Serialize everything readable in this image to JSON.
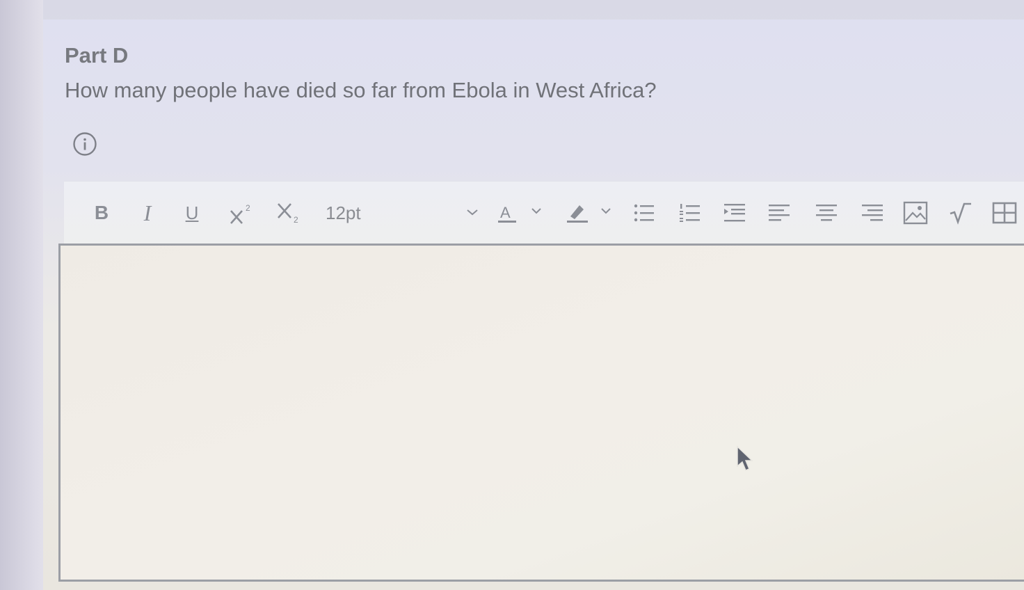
{
  "question": {
    "part_label": "Part D",
    "text": "How many people have died so far from Ebola in West Africa?",
    "info_icon": "info-circle-icon"
  },
  "editor": {
    "toolbar": {
      "bold_label": "B",
      "italic_label": "I",
      "underline_label": "U",
      "font_size": "12pt",
      "icons": [
        "bold-icon",
        "italic-icon",
        "underline-icon",
        "superscript-icon",
        "subscript-icon",
        "font-color-icon",
        "highlight-icon",
        "bullet-list-icon",
        "numbered-list-icon",
        "indent-icon",
        "align-left-icon",
        "align-center-icon",
        "align-right-icon",
        "image-icon",
        "equation-icon",
        "table-icon"
      ]
    },
    "content": "",
    "colors": {
      "icon": "#8b8e96",
      "border": "#9b9ea5"
    }
  }
}
